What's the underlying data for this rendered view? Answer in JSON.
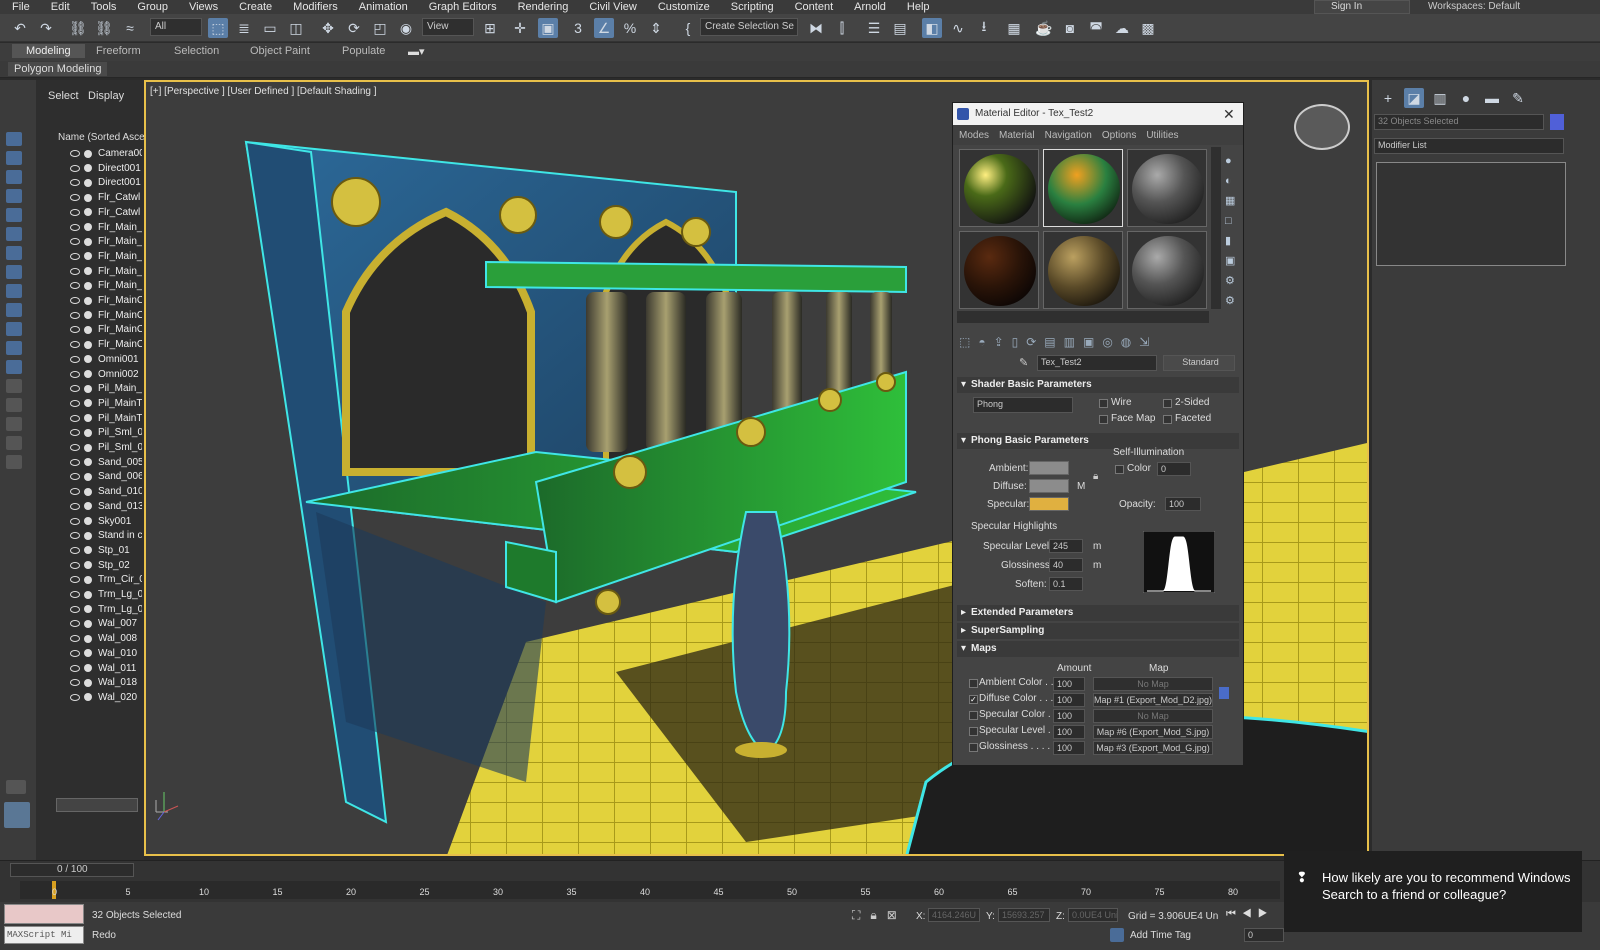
{
  "menu": [
    "File",
    "Edit",
    "Tools",
    "Group",
    "Views",
    "Create",
    "Modifiers",
    "Animation",
    "Graph Editors",
    "Rendering",
    "Civil View",
    "Customize",
    "Scripting",
    "Content",
    "Arnold",
    "Help"
  ],
  "signin": "Sign In",
  "workspace": {
    "label": "Workspaces:",
    "value": "Default"
  },
  "toolbar": {
    "filter": "All",
    "refsys": "View",
    "named_sel": "Create Selection Se"
  },
  "ribbon": {
    "tabs": [
      "Modeling",
      "Freeform",
      "Selection",
      "Object Paint",
      "Populate"
    ],
    "sub": "Polygon Modeling"
  },
  "explorer": {
    "tabs": [
      "Select",
      "Display"
    ],
    "header": "Name (Sorted Ascen",
    "items": [
      "Camera00",
      "Direct001",
      "Direct001",
      "Flr_Catwl",
      "Flr_Catwl",
      "Flr_Main_",
      "Flr_Main_",
      "Flr_Main_",
      "Flr_Main_",
      "Flr_Main_",
      "Flr_MainC",
      "Flr_MainC",
      "Flr_MainC",
      "Flr_MainC",
      "Omni001",
      "Omni002",
      "Pil_Main_",
      "Pil_MainT",
      "Pil_MainT",
      "Pil_Sml_0",
      "Pil_Sml_0",
      "Sand_005",
      "Sand_006",
      "Sand_010",
      "Sand_013",
      "Sky001",
      "Stand in c",
      "Stp_01",
      "Stp_02",
      "Trm_Cir_0",
      "Trm_Lg_0",
      "Trm_Lg_0",
      "Wal_007",
      "Wal_008",
      "Wal_010",
      "Wal_011",
      "Wal_018",
      "Wal_020"
    ]
  },
  "viewport": {
    "label": "[+] [Perspective ] [User Defined ] [Default Shading ]"
  },
  "rightpanel": {
    "selected": "32 Objects Selected",
    "modifier_list": "Modifier List"
  },
  "mated": {
    "title": "Material Editor - Tex_Test2",
    "menu": [
      "Modes",
      "Material",
      "Navigation",
      "Options",
      "Utilities"
    ],
    "mat_name": "Tex_Test2",
    "mat_type": "Standard",
    "shader": {
      "title": "Shader Basic Parameters",
      "type": "Phong",
      "wire": "Wire",
      "two_sided": "2-Sided",
      "face_map": "Face Map",
      "faceted": "Faceted"
    },
    "phong": {
      "title": "Phong Basic Parameters",
      "ambient": "Ambient:",
      "diffuse": "Diffuse:",
      "specular": "Specular:",
      "self_illum": "Self-Illumination",
      "color": "Color",
      "color_val": "0",
      "opacity": "Opacity:",
      "opacity_val": "100",
      "m": "M"
    },
    "spec": {
      "title": "Specular Highlights",
      "level_label": "Specular Level:",
      "level": "245",
      "gloss_label": "Glossiness:",
      "gloss": "40",
      "soften_label": "Soften:",
      "soften": "0.1",
      "m": "m"
    },
    "rollouts": [
      "Extended Parameters",
      "SuperSampling",
      "Maps"
    ],
    "maps": {
      "amount": "Amount",
      "map": "Map",
      "rows": [
        {
          "name": "Ambient Color . . .",
          "amount": "100",
          "map": "No Map",
          "checked": false
        },
        {
          "name": "Diffuse Color . . . .",
          "amount": "100",
          "map": "Map #1 (Export_Mod_D2.jpg)",
          "checked": true
        },
        {
          "name": "Specular Color . .",
          "amount": "100",
          "map": "No Map",
          "checked": false
        },
        {
          "name": "Specular Level . .",
          "amount": "100",
          "map": "Map #6 (Export_Mod_S.jpg)",
          "checked": false
        },
        {
          "name": "Glossiness . . . . .",
          "amount": "100",
          "map": "Map #3 (Export_Mod_G.jpg)",
          "checked": false
        }
      ]
    },
    "colors": {
      "ambient": "#8c8c8c",
      "diffuse": "#8c8c8c",
      "specular": "#e0b040"
    }
  },
  "timeline": {
    "frame": "0 / 100",
    "ticks": [
      "0",
      "5",
      "10",
      "15",
      "20",
      "25",
      "30",
      "35",
      "40",
      "45",
      "50",
      "55",
      "60",
      "65",
      "70",
      "75",
      "80"
    ]
  },
  "status": {
    "selected": "32 Objects Selected",
    "prompt": "Redo",
    "maxscript": "MAXScript Mi",
    "x_label": "X:",
    "x": "4164.246U",
    "y_label": "Y:",
    "y": "15693.257",
    "z_label": "Z:",
    "z": "0.0UE4 Uni",
    "grid": "Grid = 3.906UE4 Un",
    "add_tag": "Add Time Tag",
    "frame_field": "0"
  },
  "toast": {
    "text": "How likely are you to recommend Windows Search to a friend or colleague?"
  }
}
